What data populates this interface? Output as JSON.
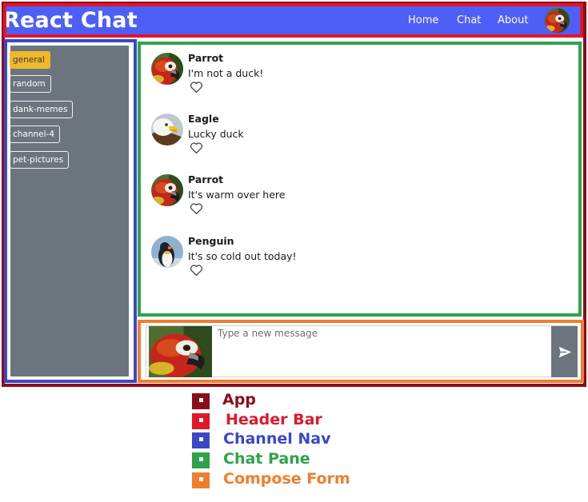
{
  "header": {
    "brand": "React Chat",
    "nav": {
      "home": "Home",
      "chat": "Chat",
      "about": "About"
    }
  },
  "channels": [
    {
      "label": "general",
      "active": true
    },
    {
      "label": "random",
      "active": false
    },
    {
      "label": "dank-memes",
      "active": false
    },
    {
      "label": "channel-4",
      "active": false
    },
    {
      "label": "pet-pictures",
      "active": false
    }
  ],
  "messages": [
    {
      "author": "Parrot",
      "text": "I'm not a duck!",
      "avatar": "parrot"
    },
    {
      "author": "Eagle",
      "text": "Lucky duck",
      "avatar": "eagle"
    },
    {
      "author": "Parrot",
      "text": "It's warm over here",
      "avatar": "parrot"
    },
    {
      "author": "Penguin",
      "text": "It's so cold out today!",
      "avatar": "penguin"
    }
  ],
  "compose": {
    "placeholder": "Type a new message",
    "send_icon": "paper-plane-icon"
  },
  "legend": [
    {
      "label": "App",
      "color": "#8b0c1a"
    },
    {
      "label": "Header Bar",
      "color": "#e0162a"
    },
    {
      "label": "Channel Nav",
      "color": "#3a48c4"
    },
    {
      "label": "Chat Pane",
      "color": "#2ea34a"
    },
    {
      "label": "Compose Form",
      "color": "#f07e2e"
    }
  ],
  "colors": {
    "header_bg": "#4d5ff6",
    "nav_bg": "#6c757d",
    "active_channel": "#f0b92b",
    "send_button": "#6c757d"
  }
}
